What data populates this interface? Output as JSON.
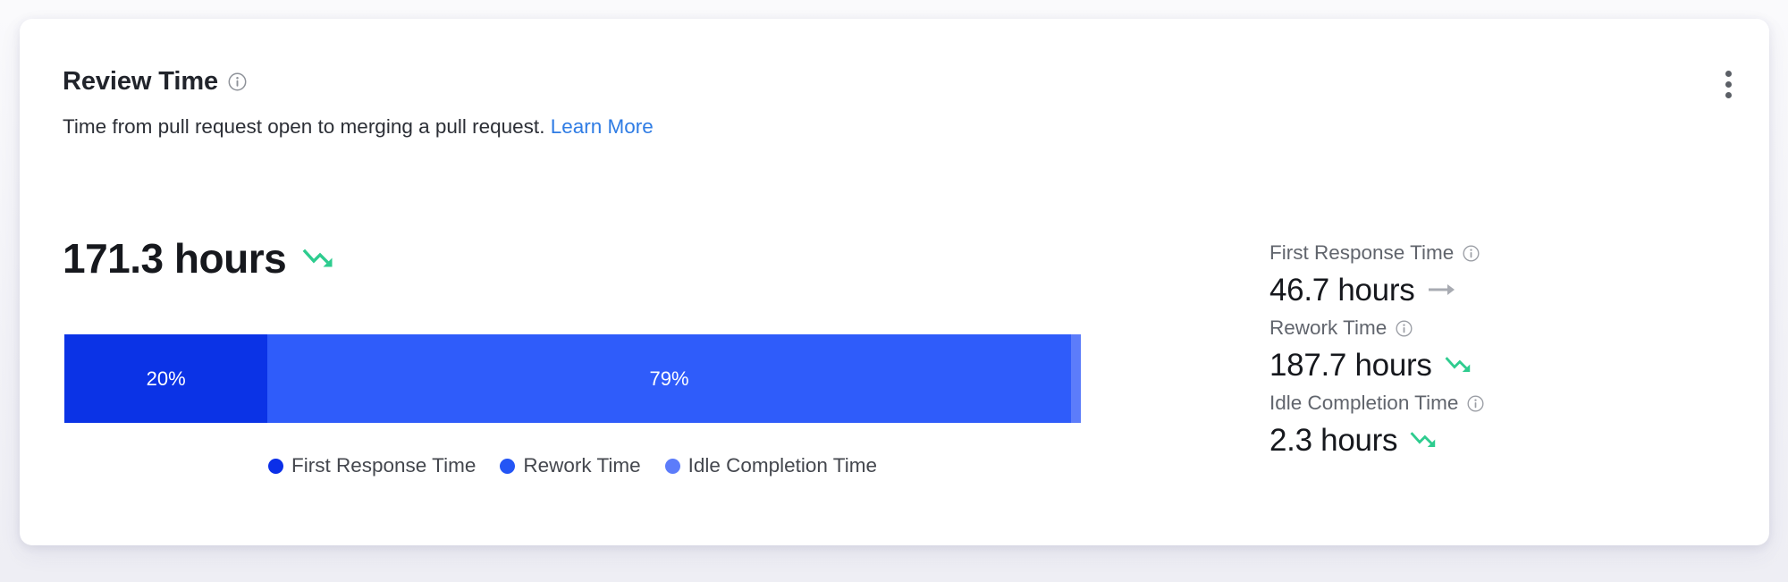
{
  "card": {
    "title": "Review Time",
    "title_info_icon": "info-circle-icon",
    "subtitle_text": "Time from pull request open to merging a pull request.",
    "learn_more_label": "Learn More",
    "menu_icon": "kebab-menu-icon"
  },
  "headline": {
    "value": "171.3 hours",
    "trend_icon": "trend-down-icon",
    "trend_color": "#2ecc8f"
  },
  "chart_data": {
    "type": "bar",
    "orientation": "horizontal-stacked",
    "title": "Review Time",
    "categories": [
      "First Response Time",
      "Rework Time",
      "Idle Completion Time"
    ],
    "values": [
      20,
      79,
      1
    ],
    "value_labels": [
      "20%",
      "79%",
      ""
    ],
    "unit": "percent",
    "total": 100,
    "colors": [
      "#0b33e6",
      "#2f5cfa",
      "#5c7cfa"
    ],
    "legend_position": "bottom-center",
    "grid": false,
    "xlabel": "",
    "ylabel": ""
  },
  "legend": [
    {
      "label": "First Response Time",
      "color": "#0b2fe8"
    },
    {
      "label": "Rework Time",
      "color": "#2455f5"
    },
    {
      "label": "Idle Completion Time",
      "color": "#5c7cfa"
    }
  ],
  "metrics": [
    {
      "label": "First Response Time",
      "info_icon": "info-circle-icon",
      "value": "46.7 hours",
      "trend_icon": "trend-flat-icon",
      "trend_color": "#a8abb2"
    },
    {
      "label": "Rework Time",
      "info_icon": "info-circle-icon",
      "value": "187.7 hours",
      "trend_icon": "trend-down-icon",
      "trend_color": "#2ecc8f"
    },
    {
      "label": "Idle Completion Time",
      "info_icon": "info-circle-icon",
      "value": "2.3 hours",
      "trend_icon": "trend-down-icon",
      "trend_color": "#2ecc8f"
    }
  ]
}
